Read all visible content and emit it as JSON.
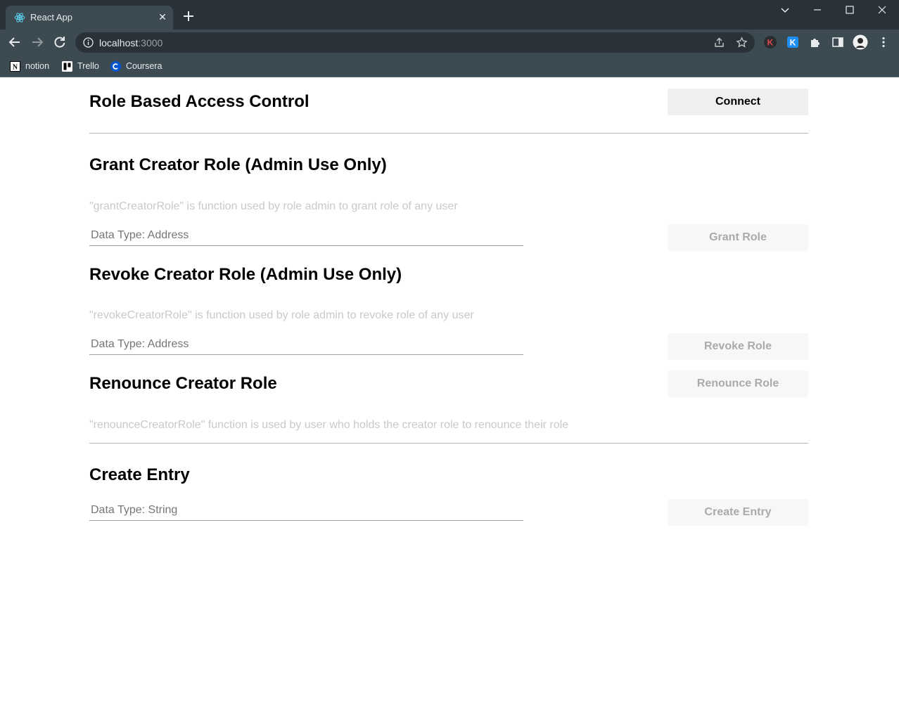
{
  "browser": {
    "tab_title": "React App",
    "url_host": "localhost",
    "url_port": ":3000",
    "bookmarks": [
      {
        "label": "notion",
        "icon": "notion-icon"
      },
      {
        "label": "Trello",
        "icon": "trello-icon"
      },
      {
        "label": "Coursera",
        "icon": "coursera-icon"
      }
    ]
  },
  "header": {
    "title": "Role Based Access Control",
    "connect_label": "Connect"
  },
  "grant": {
    "title": "Grant Creator Role (Admin Use Only)",
    "description": "\"grantCreatorRole\" is function used by role admin to grant role of any user",
    "input_placeholder": "Data Type: Address",
    "button_label": "Grant Role"
  },
  "revoke": {
    "title": "Revoke Creator Role (Admin Use Only)",
    "description": "\"revokeCreatorRole\" is function used by role admin to revoke role of any user",
    "input_placeholder": "Data Type: Address",
    "button_label": "Revoke Role"
  },
  "renounce": {
    "title": "Renounce Creator Role",
    "description": "\"renounceCreatorRole\" function is used by user who holds the creator role to renounce their role",
    "button_label": "Renounce Role"
  },
  "create": {
    "title": "Create Entry",
    "input_placeholder": "Data Type: String",
    "button_label": "Create Entry"
  },
  "colors": {
    "chrome_dark": "#293238",
    "chrome_toolbar": "#3c4a52",
    "description_text": "#c9c9c9",
    "disabled_button_bg": "#f7f7f7",
    "disabled_button_text": "#aaaaaa"
  }
}
